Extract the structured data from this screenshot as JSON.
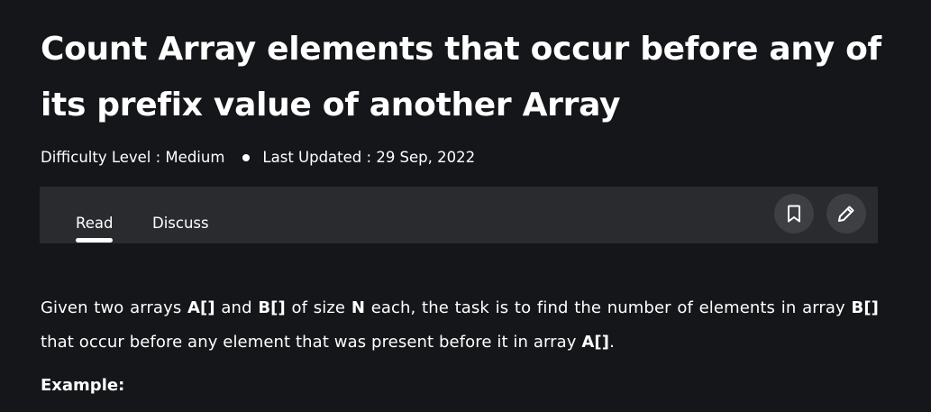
{
  "article": {
    "title": "Count Array elements that occur before any of its prefix value of another Array",
    "difficulty": "Difficulty Level : Medium",
    "last_updated": "Last Updated : 29 Sep, 2022"
  },
  "tabs": {
    "read": "Read",
    "discuss": "Discuss"
  },
  "actions": {
    "bookmark_icon": "bookmark-icon",
    "edit_icon": "pencil-icon"
  },
  "content": {
    "p1_a": "Given two arrays ",
    "p1_b": "A[]",
    "p1_c": " and ",
    "p1_d": "B[]",
    "p1_e": " of size ",
    "p1_f": "N",
    "p1_g": " each, the task is to find the number of elements in array ",
    "p1_h": "B[]",
    "p1_i": " that occur before any element that was present before it in array ",
    "p1_j": "A[]",
    "p1_k": ".",
    "example_heading": "Example:"
  },
  "colors": {
    "background": "#151619",
    "tabbar": "#2a2b2e",
    "icon_button": "#3e3f43",
    "text": "#ffffff"
  }
}
